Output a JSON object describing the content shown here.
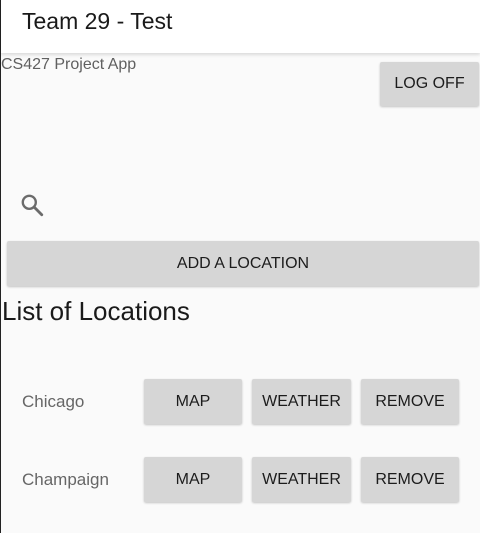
{
  "app_bar": {
    "title": "Team 29 - Test"
  },
  "subtitle": "CS427 Project App",
  "log_off_label": "LOG OFF",
  "search": {
    "icon": "search-icon"
  },
  "add_location_label": "ADD A LOCATION",
  "list_heading": "List of Locations",
  "locations": [
    {
      "name": "Chicago",
      "map_label": "MAP",
      "weather_label": "WEATHER",
      "remove_label": "REMOVE"
    },
    {
      "name": "Champaign",
      "map_label": "MAP",
      "weather_label": "WEATHER",
      "remove_label": "REMOVE"
    }
  ]
}
